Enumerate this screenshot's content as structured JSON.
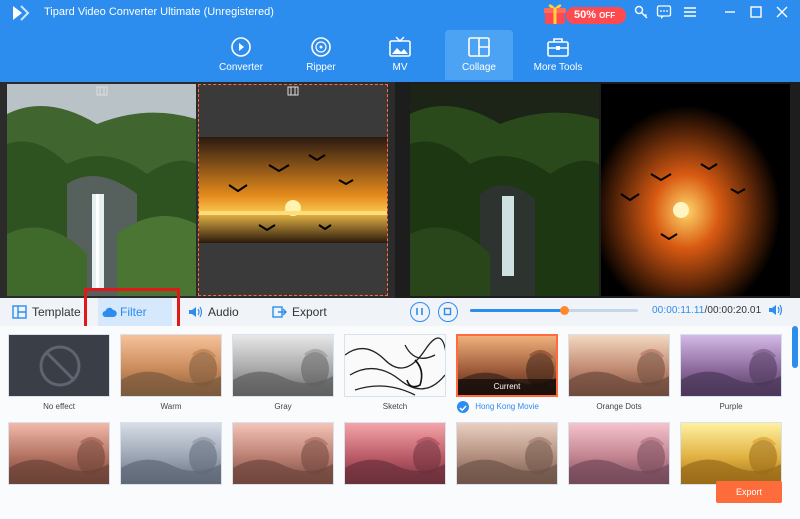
{
  "app": {
    "title": "Tipard Video Converter Ultimate (Unregistered)"
  },
  "promo": {
    "percent": "50%",
    "suffix": "OFF"
  },
  "nav": [
    {
      "label": "Converter",
      "icon": "converter-icon"
    },
    {
      "label": "Ripper",
      "icon": "ripper-icon"
    },
    {
      "label": "MV",
      "icon": "mv-icon"
    },
    {
      "label": "Collage",
      "icon": "collage-icon",
      "active": true
    },
    {
      "label": "More Tools",
      "icon": "toolbox-icon"
    }
  ],
  "tabs": {
    "template": "Template",
    "filter": "Filter",
    "audio": "Audio",
    "export": "Export"
  },
  "playback": {
    "current": "00:00:11.11",
    "total": "/00:00:20.01",
    "progress": 0.56
  },
  "filters": [
    {
      "label": "No effect",
      "tone": "none"
    },
    {
      "label": "Warm",
      "tone": "warm"
    },
    {
      "label": "Gray",
      "tone": "gray"
    },
    {
      "label": "Sketch",
      "tone": "sketch"
    },
    {
      "label": "Hong Kong Movie",
      "tone": "hongkong",
      "selected": true,
      "badge": "Current"
    },
    {
      "label": "Orange Dots",
      "tone": "orangedots"
    },
    {
      "label": "Purple",
      "tone": "purple"
    },
    {
      "label": "",
      "tone": "rose"
    },
    {
      "label": "",
      "tone": "mosaic"
    },
    {
      "label": "",
      "tone": "pinkwarm"
    },
    {
      "label": "",
      "tone": "pinkred"
    },
    {
      "label": "",
      "tone": "pixelate"
    },
    {
      "label": "",
      "tone": "rosy"
    },
    {
      "label": "",
      "tone": "golden"
    }
  ],
  "export_button": "Export",
  "colors": {
    "accent": "#2c8dee",
    "highlight": "#e21818",
    "export": "#ff6c3b"
  }
}
